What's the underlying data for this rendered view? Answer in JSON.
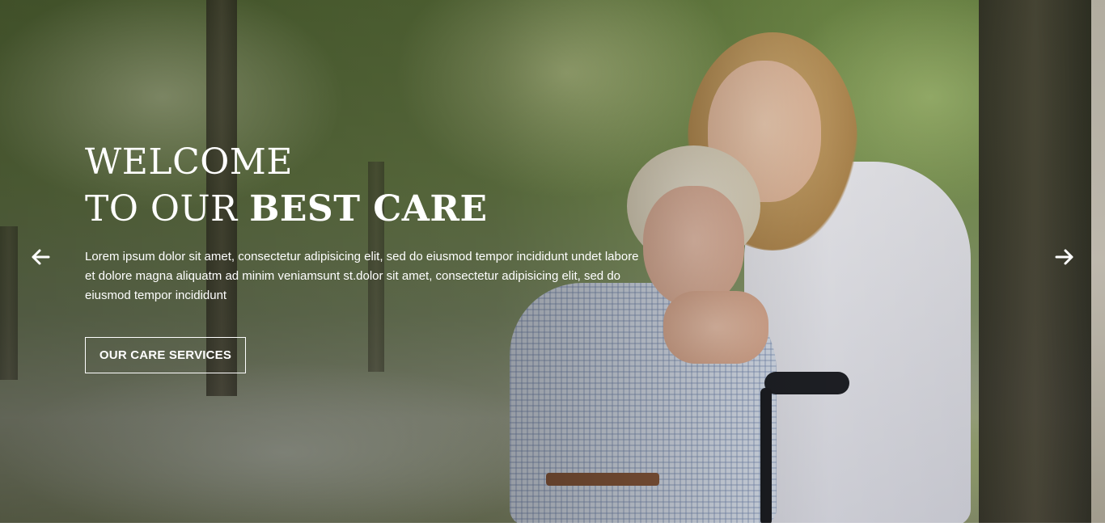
{
  "hero": {
    "title_line1": "WELCOME",
    "title_line2_regular": "TO OUR ",
    "title_line2_bold": "BEST CARE",
    "description": "Lorem ipsum dolor sit amet, consectetur adipisicing elit, sed do eiusmod tempor incididunt undet labore et dolore magna aliquatm ad minim veniamsunt st.dolor sit amet, consectetur adipisicing elit, sed do eiusmod tempor incididunt",
    "cta_label": "OUR CARE SERVICES"
  },
  "slider": {
    "prev_icon": "arrow-left-icon",
    "next_icon": "arrow-right-icon"
  },
  "colors": {
    "text": "#ffffff",
    "button_border": "#ffffff"
  }
}
